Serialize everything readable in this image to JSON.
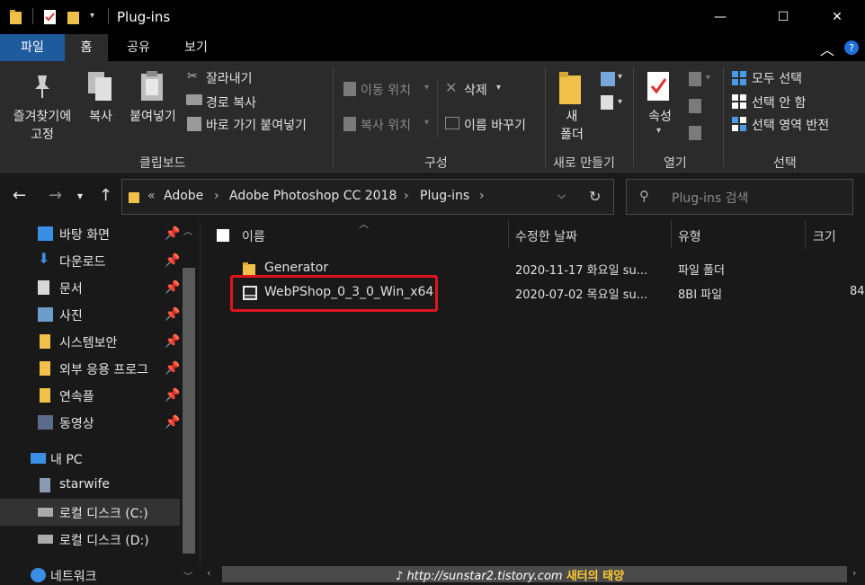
{
  "window": {
    "title": "Plug-ins",
    "minimize_glyph": "—",
    "maximize_glyph": "☐",
    "close_glyph": "✕"
  },
  "tabs": [
    {
      "label": "파일"
    },
    {
      "label": "홈"
    },
    {
      "label": "공유"
    },
    {
      "label": "보기"
    }
  ],
  "ribbon": {
    "pin_label_1": "즐겨찾기에",
    "pin_label_2": "고정",
    "copy_label": "복사",
    "paste_label": "붙여넣기",
    "cut_label": "잘라내기",
    "copy_path_label": "경로 복사",
    "paste_shortcut_label": "바로 가기 붙여넣기",
    "clipboard_group": "클립보드",
    "move_to_label": "이동 위치",
    "copy_to_label": "복사 위치",
    "delete_label": "삭제",
    "rename_label": "이름 바꾸기",
    "organize_group": "구성",
    "new_folder_label_1": "새",
    "new_folder_label_2": "폴더",
    "new_group": "새로 만들기",
    "properties_label": "속성",
    "open_group": "열기",
    "select_all_label": "모두 선택",
    "select_none_label": "선택 안 함",
    "invert_selection_label": "선택 영역 반전",
    "select_group": "선택"
  },
  "address": {
    "crumb_prefix": "«",
    "crumbs": [
      "Adobe",
      "Adobe Photoshop CC 2018",
      "Plug-ins"
    ],
    "search_placeholder": "Plug-ins 검색"
  },
  "nav": {
    "quick": [
      {
        "label": "바탕 화면",
        "icon": "desktop-icon"
      },
      {
        "label": "다운로드",
        "icon": "download-icon"
      },
      {
        "label": "문서",
        "icon": "document-icon"
      },
      {
        "label": "사진",
        "icon": "picture-icon"
      },
      {
        "label": "시스템보안",
        "icon": "folder-icon"
      },
      {
        "label": "외부 응용 프로그",
        "icon": "folder-icon"
      },
      {
        "label": "연속플",
        "icon": "folder-icon"
      },
      {
        "label": "동영상",
        "icon": "video-icon"
      }
    ],
    "this_pc": "내 PC",
    "user": "starwife",
    "drive_c": "로컬 디스크 (C:)",
    "drive_d": "로컬 디스크 (D:)",
    "network": "네트워크"
  },
  "columns": {
    "name": "이름",
    "modified": "수정한 날짜",
    "type": "유형",
    "size": "크기"
  },
  "files": [
    {
      "name": "Generator",
      "modified": "2020-11-17 화요일 su...",
      "type": "파일 폴더",
      "size": ""
    },
    {
      "name": "WebPShop_0_3_0_Win_x64",
      "modified": "2020-07-02 목요일 su...",
      "type": "8BI 파일",
      "size": "84"
    }
  ],
  "watermark": {
    "url": "http://sunstar2.tistory.com",
    "brand": "새터의 태양"
  },
  "colors": {
    "accent": "#1d5a9e",
    "highlight": "#e0141e",
    "folder": "#f0c04a"
  }
}
